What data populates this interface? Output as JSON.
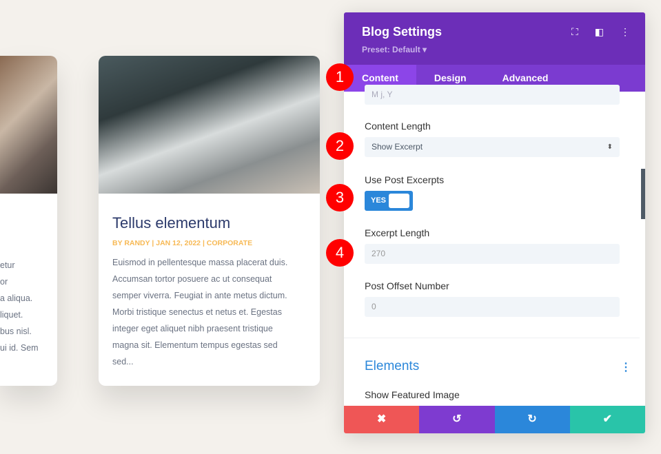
{
  "cards": [
    {
      "body_lines": [
        "etur",
        "or",
        "a aliqua.",
        "liquet.",
        "bus nisl.",
        "ui id. Sem"
      ]
    },
    {
      "title": "Tellus elementum",
      "meta": "BY RANDY | JAN 12, 2022 | CORPORATE",
      "body_lines": [
        "Euismod in pellentesque massa placerat duis.",
        "Accumsan tortor posuere ac ut consequat",
        "semper viverra. Feugiat in ante metus dictum.",
        "Morbi tristique senectus et netus et. Egestas",
        "integer eget aliquet nibh praesent tristique",
        "magna sit. Elementum tempus egestas sed",
        "sed..."
      ]
    }
  ],
  "panel": {
    "title": "Blog Settings",
    "preset": "Preset: Default ▾",
    "icons": [
      "fullscreen-icon",
      "split-view-icon",
      "more-icon"
    ],
    "tabs": [
      "Content",
      "Design",
      "Advanced"
    ],
    "active_tab": "Content",
    "date_format_value": "M j, Y",
    "content_length_label": "Content Length",
    "content_length_value": "Show Excerpt",
    "use_excerpts_label": "Use Post Excerpts",
    "use_excerpts_value": "YES",
    "excerpt_length_label": "Excerpt Length",
    "excerpt_length_placeholder": "270",
    "offset_label": "Post Offset Number",
    "offset_placeholder": "0",
    "elements_title": "Elements",
    "show_image_label": "Show Featured Image",
    "footer": {
      "cancel": "✖",
      "undo": "↺",
      "redo": "↻",
      "save": "✔"
    }
  },
  "badges": [
    "1",
    "2",
    "3",
    "4"
  ],
  "colors": {
    "header": "#6c2eb8",
    "tabs": "#7b3bd0",
    "cancel": "#ef5656",
    "undo": "#7e3bd0",
    "redo": "#2b87da",
    "save": "#29c4a9",
    "badge": "#ff0000"
  }
}
